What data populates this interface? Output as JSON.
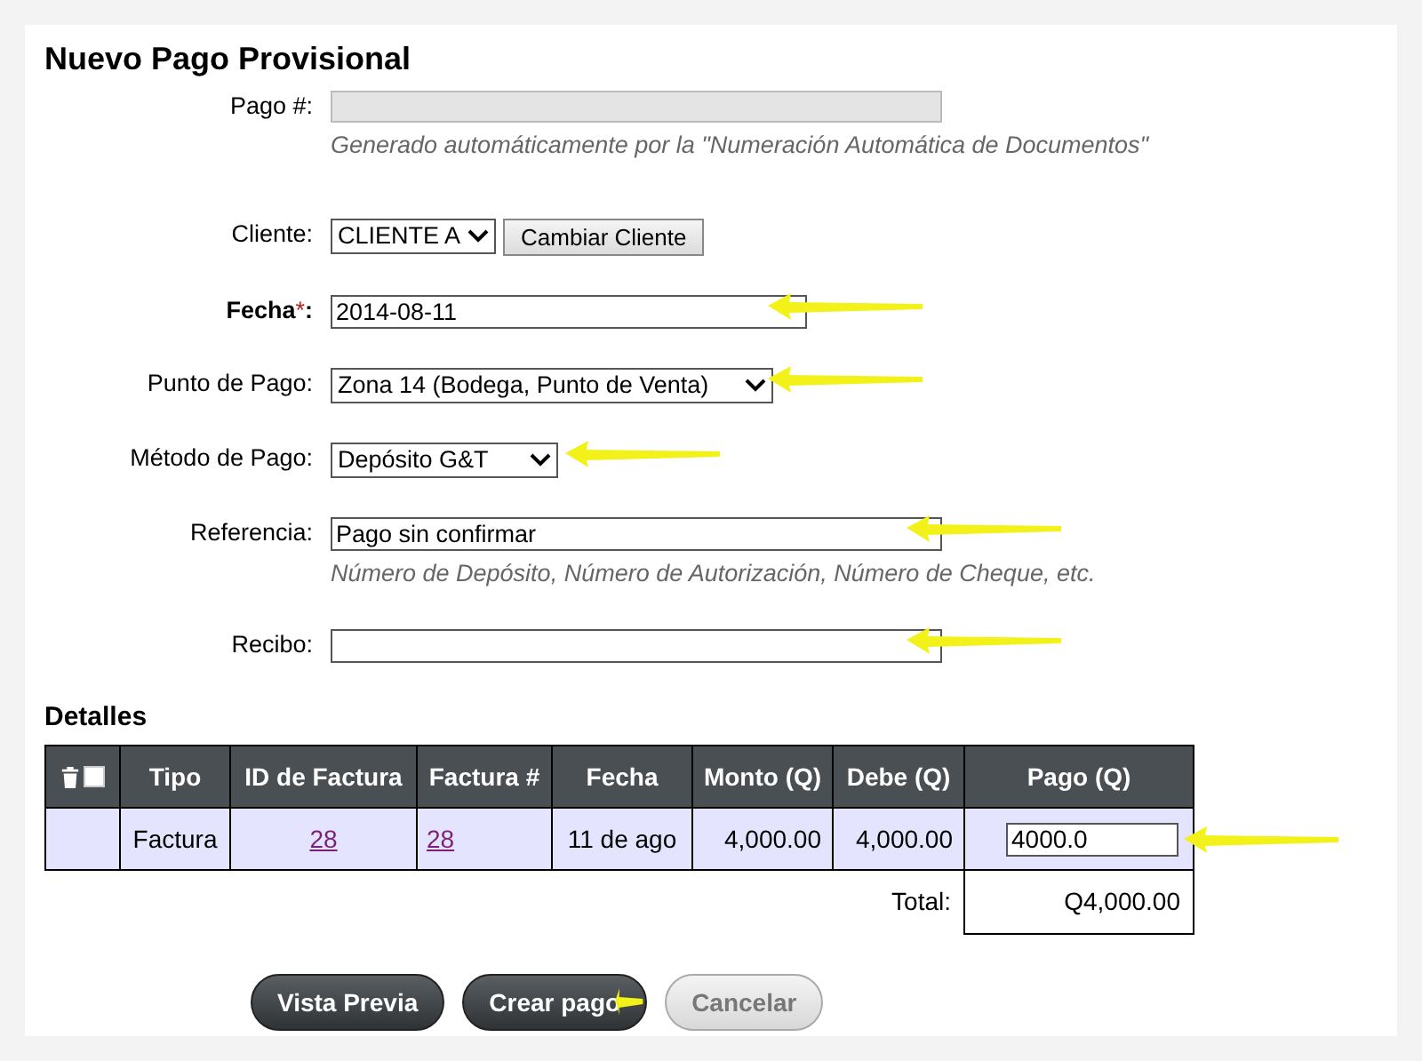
{
  "title": "Nuevo Pago Provisional",
  "fields": [
    {
      "kind": "readonly",
      "label": "Pago #:",
      "hint": "Generado automáticamente por la \"Numeración Automática de Documentos\"",
      "arrow": false
    },
    {
      "kind": "client",
      "label": "Cliente:",
      "value": "CLIENTE A",
      "button": "Cambiar Cliente",
      "arrow": false
    },
    {
      "kind": "text",
      "label": "Fecha",
      "marker": "*",
      "suffix": ":",
      "value": "2014-08-11",
      "arrow": true
    },
    {
      "kind": "select",
      "label": "Punto de Pago:",
      "value": "Zona 14 (Bodega, Punto de Venta)",
      "arrow": true
    },
    {
      "kind": "select",
      "label": "Método de Pago:",
      "value": "Depósito G&T",
      "arrow": true
    },
    {
      "kind": "text",
      "label": "Referencia:",
      "value": "Pago sin confirmar",
      "hint": "Número de Depósito, Número de Autorización, Número de Cheque, etc.",
      "arrow": true
    },
    {
      "kind": "text",
      "label": "Recibo:",
      "arrow": true
    }
  ],
  "details": {
    "title": "Detalles",
    "columns": [
      "Tipo",
      "ID de Factura",
      "Factura #",
      "Fecha",
      "Monto (Q)",
      "Debe (Q)",
      "Pago (Q)"
    ],
    "select_all_checked": false,
    "rows": [
      {
        "tipo": "Factura",
        "id": "28",
        "factura": "28",
        "fecha": "11 de ago",
        "monto": "4,000.00",
        "debe": "4,000.00",
        "pago": "4000.0",
        "arrow": true
      }
    ],
    "total_label": "Total:",
    "total": "Q4,000.00"
  },
  "buttons": [
    {
      "label": "Vista Previa",
      "disabled": false,
      "arrow": false
    },
    {
      "label": "Crear pago",
      "disabled": false,
      "arrow": true
    },
    {
      "label": "Cancelar",
      "disabled": true,
      "arrow": false
    }
  ]
}
